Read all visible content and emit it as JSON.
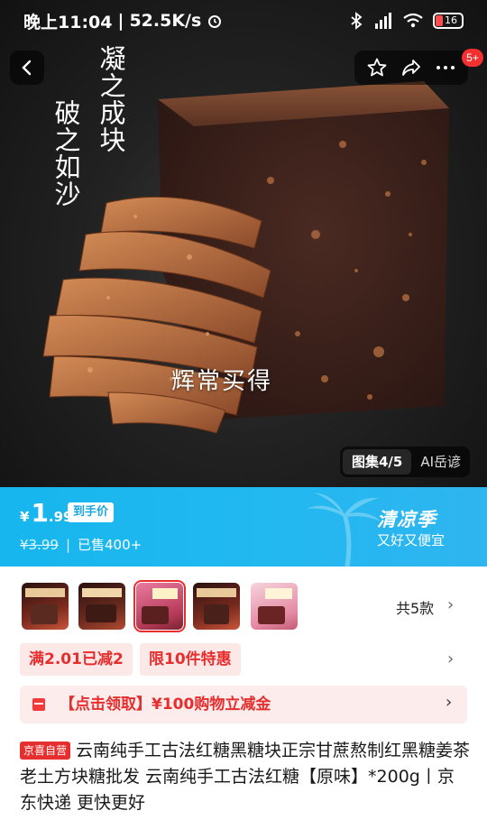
{
  "status_bar": {
    "time": "晚上11:04",
    "net_speed": "52.5K/s",
    "battery": "16"
  },
  "hero": {
    "text_right": "凝之成块",
    "text_left": "破之如沙",
    "caption": "辉常买得",
    "gallery_tab": "图集4/5",
    "ai_tab": "AI岳谚"
  },
  "top_nav": {
    "badge": "5+"
  },
  "price": {
    "currency": "¥",
    "integer": "1",
    "decimal": ".99",
    "hand_price_tag": "到手价",
    "original_price": "¥3.99",
    "sold": "已售400+"
  },
  "promo": {
    "title": "清凉季",
    "subtitle": "又好又便宜"
  },
  "variants": {
    "count_label": "共5款",
    "selected_index": 2
  },
  "discounts": {
    "tag1": "满2.01已减2",
    "tag2": "限10件特惠"
  },
  "coupon": {
    "text": "【点击领取】¥100购物立减金"
  },
  "product": {
    "badge": "京喜自营",
    "title": "云南纯手工古法红糖黑糖块正宗甘蔗熬制红黑糖姜茶老土方块糖批发 云南纯手工古法红糖【原味】*200g丨京东快递 更快更好"
  },
  "colors": {
    "price_band": "#22b8f0",
    "accent_red": "#e62e2e",
    "tag_bg": "#fde8e8"
  }
}
